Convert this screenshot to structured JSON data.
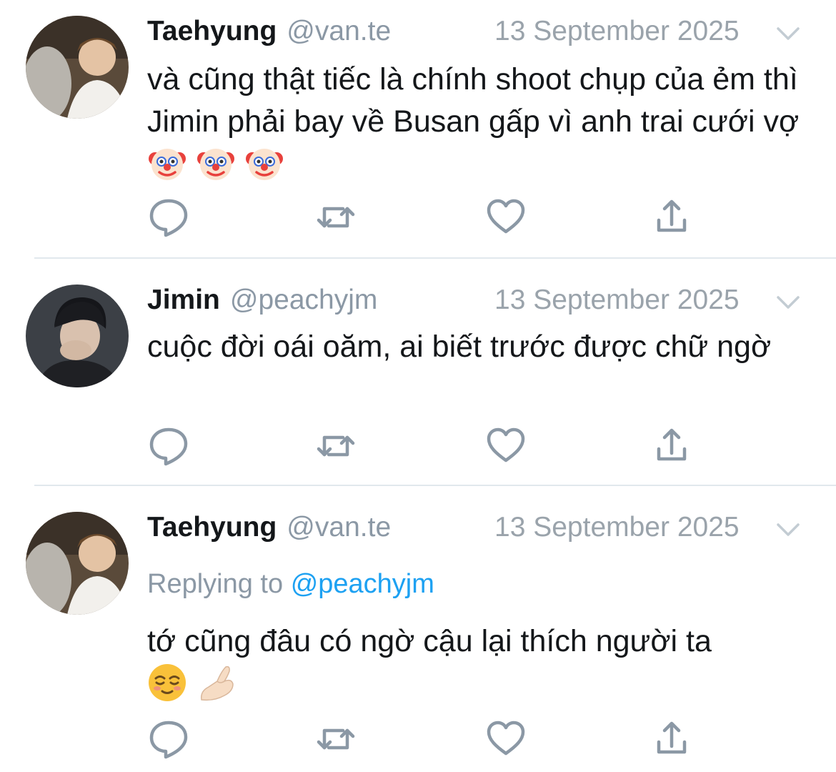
{
  "tweets": [
    {
      "name": "Taehyung",
      "handle": "@van.te",
      "date": "13 September 2025",
      "text": "và cũng thật tiếc là chính shoot chụp của ẻm thì Jimin phải bay về Busan gấp vì anh trai cưới vợ",
      "emojis": [
        "clown-face-emoji",
        "clown-face-emoji",
        "clown-face-emoji"
      ]
    },
    {
      "name": "Jimin",
      "handle": "@peachyjm",
      "date": "13 September 2025",
      "text": "cuộc đời oái oăm, ai biết trước được chữ ngờ"
    },
    {
      "name": "Taehyung",
      "handle": "@van.te",
      "date": "13 September 2025",
      "replying_prefix": "Replying to",
      "replying_to": "@peachyjm",
      "text": "tớ cũng đâu có ngờ cậu lại thích người ta",
      "emojis": [
        "relieved-face-emoji",
        "pinching-hand-emoji"
      ]
    }
  ],
  "actions": [
    "reply-icon",
    "retweet-icon",
    "like-icon",
    "share-icon"
  ],
  "colors": {
    "icon": "#8b98a5",
    "mention": "#1da1f2",
    "divider": "#e1e8ed"
  }
}
